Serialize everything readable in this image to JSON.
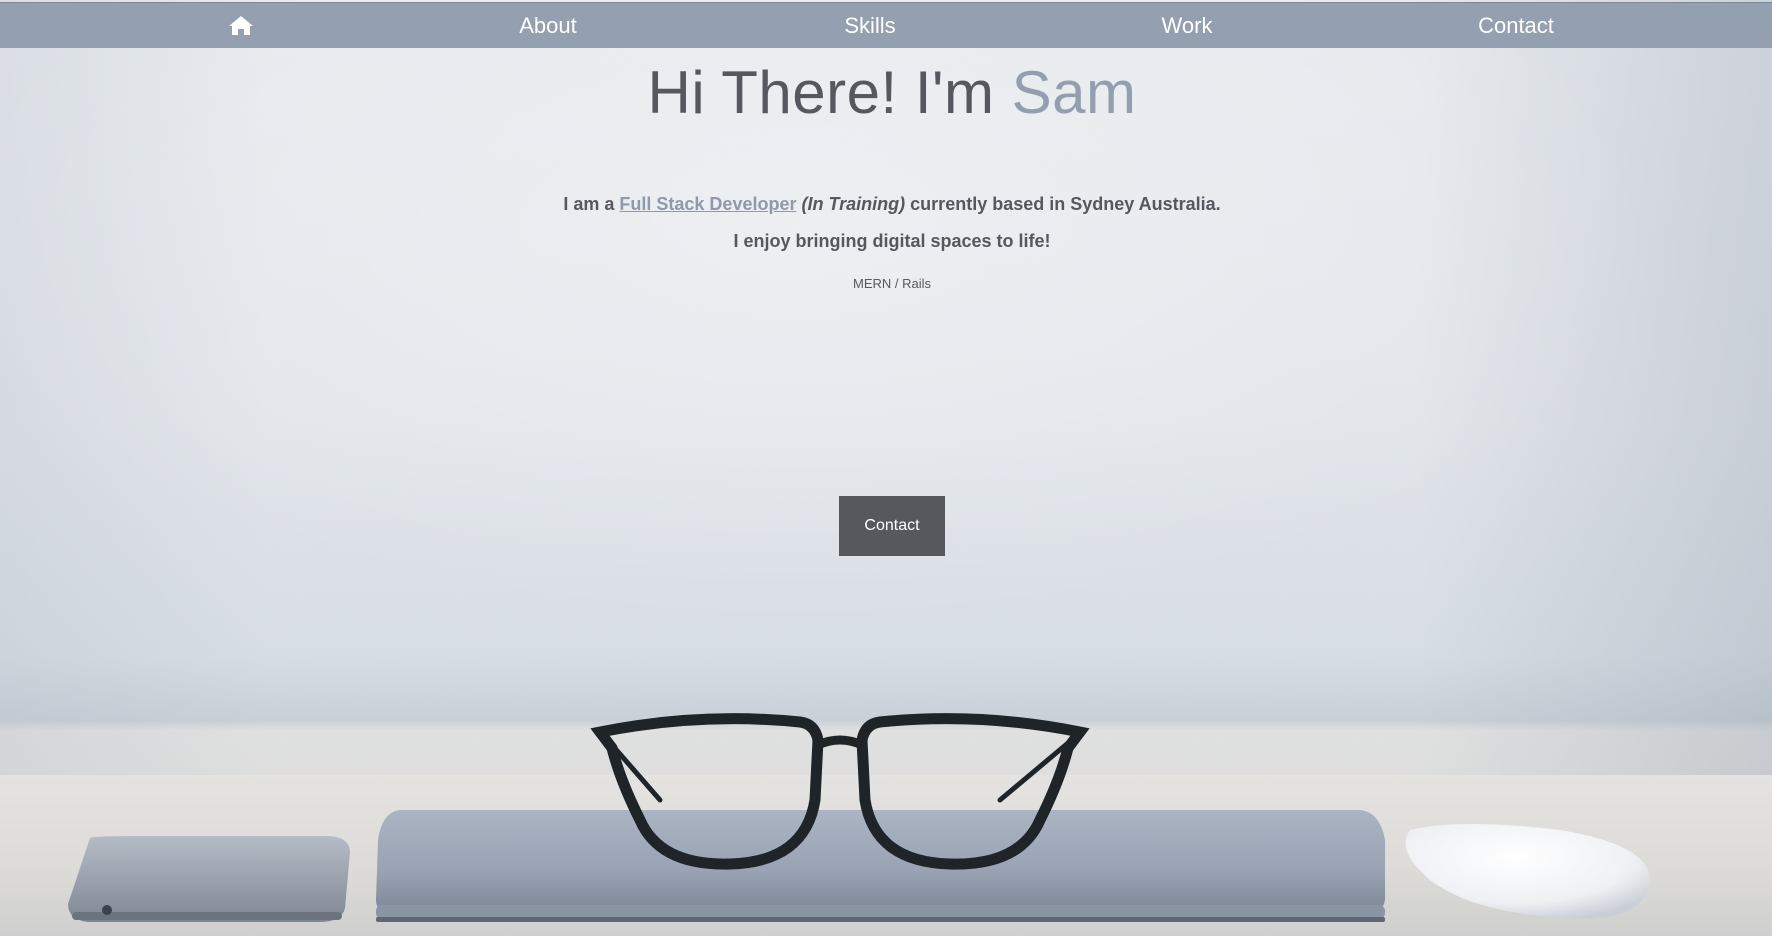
{
  "nav": {
    "home_icon": "home-icon",
    "items": [
      {
        "label": "About"
      },
      {
        "label": "Skills"
      },
      {
        "label": "Work"
      },
      {
        "label": "Contact"
      }
    ]
  },
  "hero": {
    "greeting": "Hi There! I'm ",
    "name": "Sam",
    "intro_prefix": "I am a ",
    "role_link": "Full Stack Developer",
    "role_qualifier": "(In Training)",
    "intro_suffix": " currently based in Sydney Australia.",
    "tagline": "I enjoy bringing digital spaces to life!",
    "stack": "MERN / Rails",
    "cta_label": "Contact"
  },
  "colors": {
    "nav_bg": "#949fb0",
    "text": "#55585e",
    "accent": "#949eae",
    "button_bg": "#55585d"
  }
}
